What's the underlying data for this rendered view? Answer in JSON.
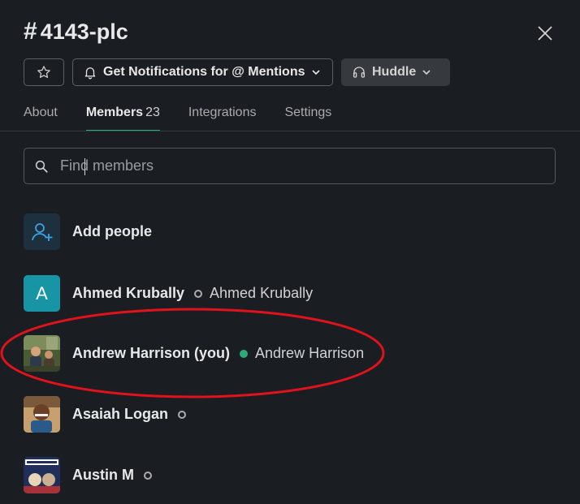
{
  "header": {
    "hash": "#",
    "channel_name": "4143-plc",
    "star_icon": "star-icon",
    "notifications_label": "Get Notifications for @ Mentions",
    "huddle_label": "Huddle"
  },
  "tabs": [
    {
      "label": "About"
    },
    {
      "label": "Members",
      "count": "23"
    },
    {
      "label": "Integrations"
    },
    {
      "label": "Settings"
    }
  ],
  "search": {
    "placeholder": "Find members",
    "value": ""
  },
  "members": [
    {
      "display_name": "Add people",
      "icon": "add-person-icon"
    },
    {
      "display_name": "Ahmed Krubally",
      "full_name": "Ahmed Krubally",
      "avatar_letter": "A",
      "status": "away"
    },
    {
      "display_name": "Andrew Harrison (you)",
      "full_name": "Andrew Harrison",
      "status": "active"
    },
    {
      "display_name": "Asaiah Logan",
      "status": "away"
    },
    {
      "display_name": "Austin M",
      "status": "away"
    }
  ],
  "colors": {
    "background": "#1a1d21",
    "active_tab_underline": "#2bac76",
    "active_status": "#2bac76",
    "avatar_teal": "#1795a5",
    "annotation_red": "#e0121c"
  }
}
